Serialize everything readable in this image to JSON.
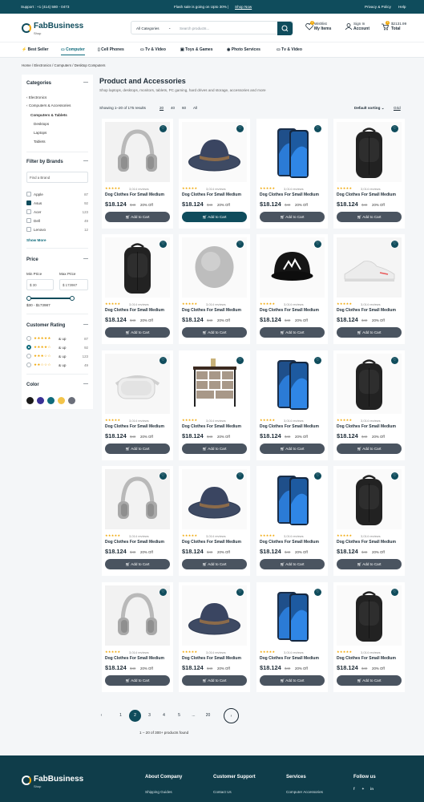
{
  "topbar": {
    "support": "Support : +1 (414) 580 - 0473",
    "flash": "Flash sale is going on Upto 30% |",
    "shop_now": "Shop Now",
    "privacy": "Privacy & Policy",
    "help": "Help"
  },
  "brand": {
    "name": "FabBusiness",
    "sub": "Shop"
  },
  "search": {
    "category": "All Categories",
    "placeholder": "Search products..."
  },
  "header": {
    "wishlist_top": "Wishlist",
    "wishlist": "My Items",
    "signin_top": "Sign In",
    "signin": "Account",
    "cart_top": "$2131.99",
    "cart": "Total",
    "wish_count": "2",
    "cart_count": "3"
  },
  "nav": {
    "items": [
      "Best Seller",
      "Computer",
      "Cell Phones",
      "Tv & Video",
      "Toys & Games",
      "Photo Services",
      "Tv & Video"
    ]
  },
  "breadcrumb": [
    "Home",
    "Electronics",
    "Computers",
    "Desktop Computers"
  ],
  "sidebar": {
    "categories_title": "Categories",
    "categories": [
      "Electronics",
      "Computers & Accessories",
      "Computers & Tablets",
      "Desktops",
      "Laptops",
      "Tablets"
    ],
    "brands_title": "Filter by Brands",
    "brand_search": "Find a Brand",
    "brands": [
      {
        "name": "Apple",
        "count": "87",
        "checked": false
      },
      {
        "name": "Asus",
        "count": "92",
        "checked": true
      },
      {
        "name": "Acer",
        "count": "123",
        "checked": false
      },
      {
        "name": "Dell",
        "count": "49",
        "checked": false
      },
      {
        "name": "Lenovo",
        "count": "12",
        "checked": false
      }
    ],
    "show_more": "Show More",
    "price_title": "Price",
    "min_label": "Min Price",
    "max_label": "Max Price",
    "min_value": "$ 30",
    "max_value": "$ 173987",
    "range_text": "$30 - $173987",
    "rating_title": "Customer Rating",
    "ratings": [
      {
        "stars": "★★★★★",
        "text": "& up",
        "count": "87"
      },
      {
        "stars": "★★★★☆",
        "text": "& up",
        "count": "92"
      },
      {
        "stars": "★★★☆☆",
        "text": "& up",
        "count": "123"
      },
      {
        "stars": "★★☆☆☆",
        "text": "& up",
        "count": "49"
      }
    ],
    "color_title": "Color",
    "colors": [
      "#1a1a1a",
      "#3a3196",
      "#0f6b7c",
      "#f3c44a",
      "#6b6f7a"
    ]
  },
  "main": {
    "title": "Product and Accessories",
    "subtitle": "Shop laptops, desktops, monitors, tablets, PC gaming, hard drives and storage, accessories and more",
    "showing": "Showing 1–20 of 175 results",
    "per_page": [
      "20",
      "40",
      "60",
      "All"
    ],
    "sort": "Default sorting",
    "view": "Grid"
  },
  "product": {
    "stars": "★★★★★",
    "reviews": "3,014 reviews",
    "name": "Dog Clothes For Small Medium",
    "price": "$18.124",
    "old": "$48",
    "off": "20% Off",
    "add": "Add to Cart"
  },
  "product_images": [
    [
      "headphones",
      "hat",
      "phone",
      "backpack"
    ],
    [
      "backpack",
      "speaker",
      "cap",
      "shoe"
    ],
    [
      "vr",
      "dresser",
      "phone",
      "backpack"
    ],
    [
      "headphones",
      "hat",
      "phone",
      "backpack"
    ],
    [
      "headphones",
      "hat",
      "phone",
      "backpack"
    ]
  ],
  "pagination": {
    "pages": [
      "1",
      "2",
      "3",
      "4",
      "5",
      "...",
      "20"
    ],
    "current": "2",
    "found": "1 – 20 of 300+ products found"
  },
  "footer": {
    "about": "About Company",
    "support": "Customer Support",
    "services": "Services",
    "follow": "Follow us",
    "link1": "Shipping Guides",
    "link2": "Contact Us",
    "link3": "Computer Accessories"
  }
}
